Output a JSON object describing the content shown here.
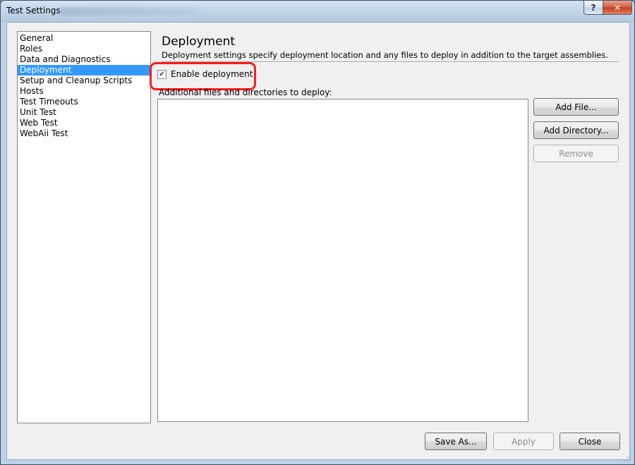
{
  "window": {
    "title": "Test Settings",
    "help_label": "?",
    "close_label": "✕"
  },
  "nav": {
    "items": [
      {
        "label": "General"
      },
      {
        "label": "Roles"
      },
      {
        "label": "Data and Diagnostics"
      },
      {
        "label": "Deployment",
        "selected": true
      },
      {
        "label": "Setup and Cleanup Scripts"
      },
      {
        "label": "Hosts"
      },
      {
        "label": "Test Timeouts"
      },
      {
        "label": "Unit Test"
      },
      {
        "label": "Web Test"
      },
      {
        "label": "WebAii Test"
      }
    ]
  },
  "deployment": {
    "title": "Deployment",
    "description": "Deployment settings specify deployment location and any files to deploy in addition to the target assemblies.",
    "enable_label": "Enable deployment",
    "enable_checked": true,
    "files_label": "Additional files and directories to deploy:"
  },
  "buttons": {
    "add_file": "Add File...",
    "add_directory": "Add Directory...",
    "remove": "Remove",
    "save_as": "Save As...",
    "apply": "Apply",
    "close": "Close"
  },
  "colors": {
    "selection": "#3399ff",
    "highlight_ring": "#ff1a1a"
  }
}
